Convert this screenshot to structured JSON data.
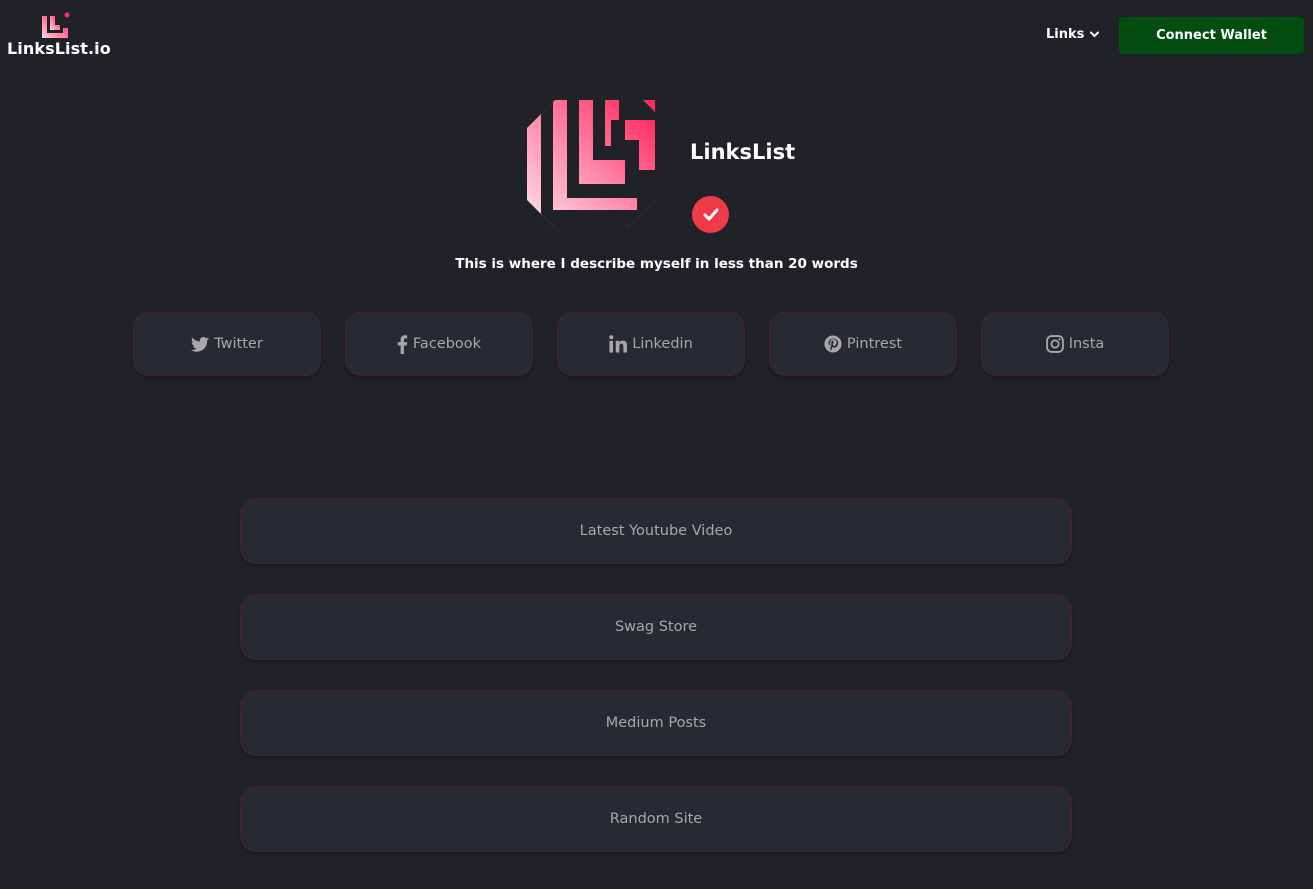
{
  "header": {
    "logo_text": "LinksList.io",
    "nav_links_label": "Links",
    "connect_wallet_label": "Connect Wallet"
  },
  "profile": {
    "name": "LinksList",
    "bio": "This is where I describe myself in less than 20 words"
  },
  "socials": [
    {
      "label": "Twitter",
      "icon": "twitter-icon"
    },
    {
      "label": "Facebook",
      "icon": "facebook-icon"
    },
    {
      "label": "Linkedin",
      "icon": "linkedin-icon"
    },
    {
      "label": "Pintrest",
      "icon": "pinterest-icon"
    },
    {
      "label": "Insta",
      "icon": "instagram-icon"
    }
  ],
  "links": [
    {
      "label": "Latest Youtube Video"
    },
    {
      "label": "Swag Store"
    },
    {
      "label": "Medium Posts"
    },
    {
      "label": "Random Site"
    }
  ],
  "colors": {
    "background": "#202227",
    "card": "#272a30",
    "card_border": "#4b2227",
    "accent_pink": "#ff3d6e",
    "badge_red": "#f03a47",
    "wallet_green": "#034d10",
    "muted_text": "#a7a7aa"
  }
}
